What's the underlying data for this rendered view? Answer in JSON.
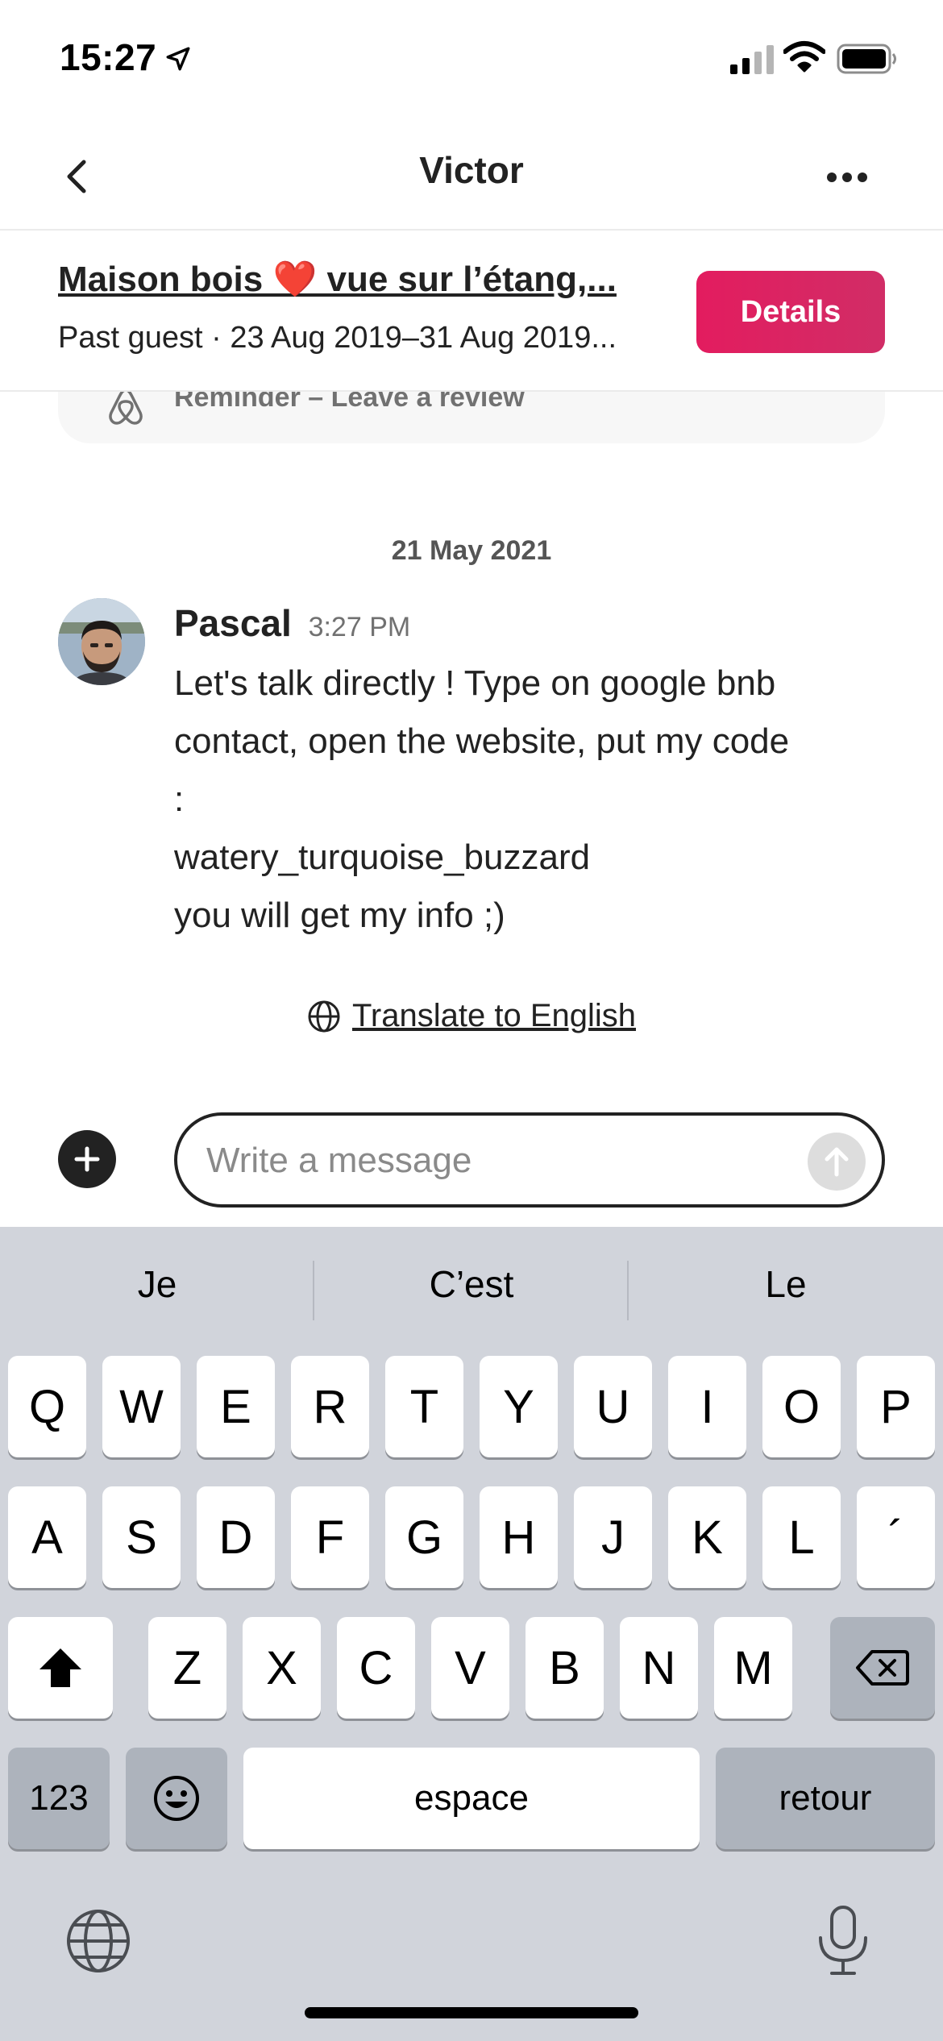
{
  "status_bar": {
    "time": "15:27"
  },
  "nav": {
    "title": "Victor"
  },
  "listing": {
    "title": "Maison bois ❤️ vue sur l’étang,...",
    "subtitle": "Past guest · 23 Aug 2019–31 Aug 2019...",
    "details_label": "Details"
  },
  "reminder": {
    "text": "Reminder – Leave a review"
  },
  "thread": {
    "date": "21 May 2021",
    "message": {
      "sender": "Pascal",
      "time": "3:27 PM",
      "body": "Let's talk directly ! Type on google bnb\ncontact, open the website, put my code\n:\nwatery_turquoise_buzzard\n you will get my info ;)"
    },
    "translate_label": "Translate to English"
  },
  "composer": {
    "placeholder": "Write a message"
  },
  "keyboard": {
    "suggestions": [
      "Je",
      "C’est",
      "Le"
    ],
    "row1": [
      "Q",
      "W",
      "E",
      "R",
      "T",
      "Y",
      "U",
      "I",
      "O",
      "P"
    ],
    "row2": [
      "A",
      "S",
      "D",
      "F",
      "G",
      "H",
      "J",
      "K",
      "L",
      "´"
    ],
    "row3": [
      "Z",
      "X",
      "C",
      "V",
      "B",
      "N",
      "M"
    ],
    "numbers_label": "123",
    "space_label": "espace",
    "return_label": "retour"
  },
  "icons": {
    "back": "chevron-left-icon",
    "more": "more-horizontal-icon",
    "translate": "globe-icon",
    "add": "plus-icon",
    "send": "arrow-up-icon",
    "shift": "shift-icon",
    "delete": "backspace-icon",
    "emoji": "emoji-icon",
    "language": "globe-icon",
    "dictation": "microphone-icon"
  },
  "colors": {
    "accent": "#E31C5F",
    "text": "#222222",
    "keyboard_bg": "#D1D4DB"
  }
}
